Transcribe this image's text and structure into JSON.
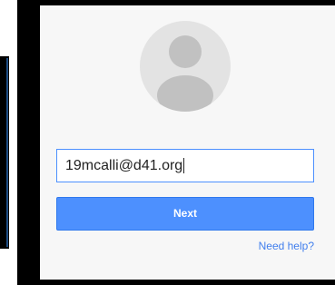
{
  "signin": {
    "email_value": "19mcalli@d41.org",
    "next_label": "Next",
    "help_label": "Need help?"
  },
  "icons": {
    "avatar": "default-user-avatar-icon"
  },
  "colors": {
    "accent": "#4d90fe",
    "link": "#427fed",
    "card_background": "#f7f7f7",
    "avatar_background": "#e3e3e3",
    "avatar_silhouette": "#c1c1c1"
  }
}
